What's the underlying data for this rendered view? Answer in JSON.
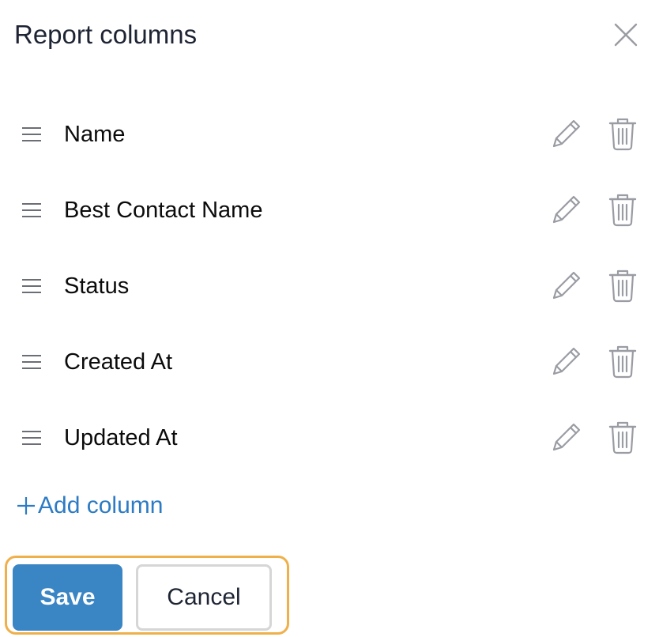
{
  "dialog": {
    "title": "Report columns",
    "close_icon": "close-icon"
  },
  "columns": [
    {
      "label": "Name"
    },
    {
      "label": "Best Contact Name"
    },
    {
      "label": "Status"
    },
    {
      "label": "Created At"
    },
    {
      "label": "Updated At"
    }
  ],
  "row_icons": {
    "drag": "drag-handle-icon",
    "edit": "pencil-icon",
    "delete": "trash-icon"
  },
  "add_column": {
    "label": "Add column",
    "icon": "plus-icon"
  },
  "actions": {
    "save_label": "Save",
    "cancel_label": "Cancel"
  },
  "colors": {
    "primary": "#3a85c4",
    "link": "#2c7bc4",
    "focus_ring": "#efb04a",
    "icon_gray": "#9a9ca3"
  }
}
